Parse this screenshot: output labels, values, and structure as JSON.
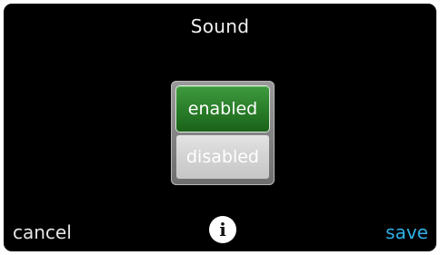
{
  "header": {
    "title": "Sound"
  },
  "toggle": {
    "options": [
      {
        "label": "enabled",
        "selected": true
      },
      {
        "label": "disabled",
        "selected": false
      }
    ]
  },
  "footer": {
    "cancel_label": "cancel",
    "info_glyph": "i",
    "save_label": "save"
  },
  "colors": {
    "background": "#000000",
    "selected_option": "#2c822c",
    "unselected_option": "#d4d4d4",
    "save_accent": "#2fb0e6"
  },
  "icons": {
    "info": "info-icon"
  }
}
